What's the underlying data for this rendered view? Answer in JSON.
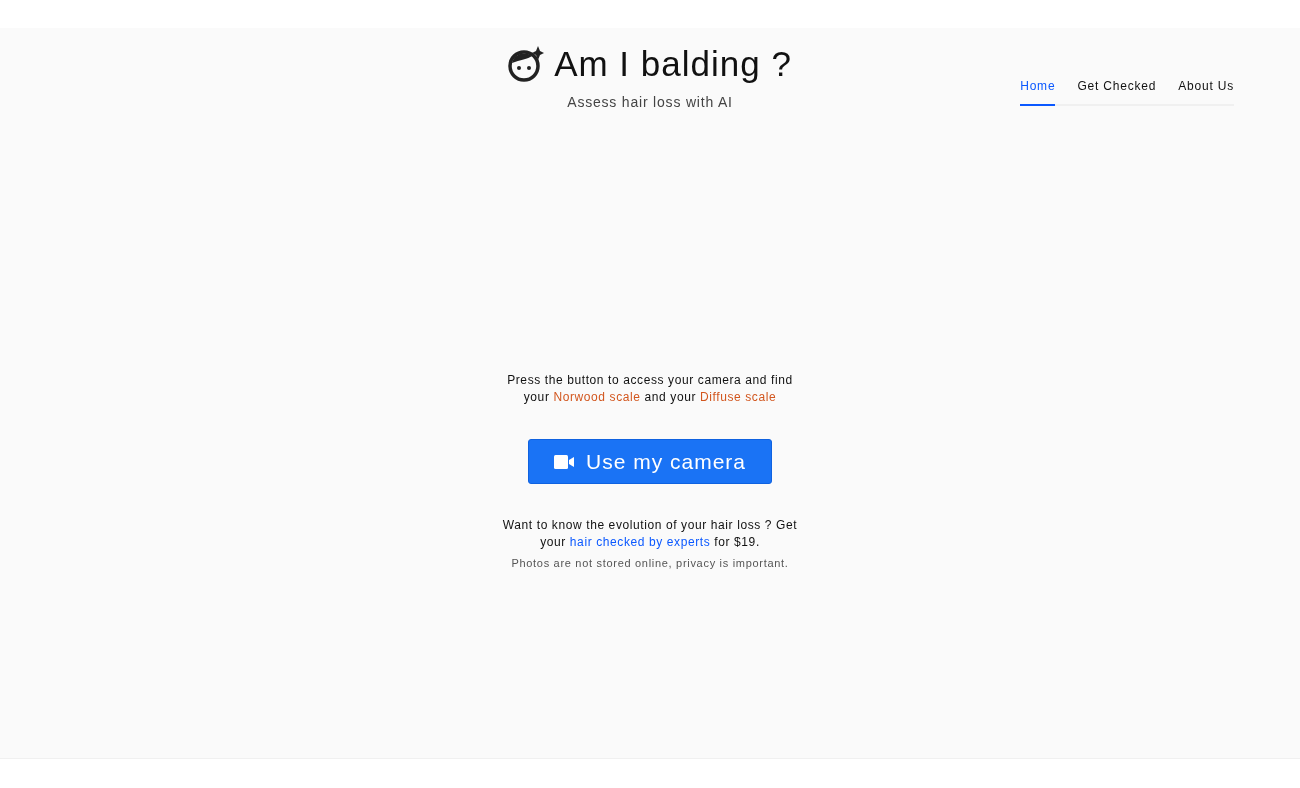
{
  "header": {
    "title": "Am I balding ?",
    "subtitle": "Assess hair loss with AI"
  },
  "nav": [
    {
      "label": "Home",
      "selected": true
    },
    {
      "label": "Get Checked",
      "selected": false
    },
    {
      "label": "About Us",
      "selected": false
    }
  ],
  "intro": [
    {
      "kind": "text",
      "text": "Press the button to access your camera and find your "
    },
    {
      "kind": "scale-link",
      "text": "Norwood scale"
    },
    {
      "kind": "text",
      "text": " and your "
    },
    {
      "kind": "scale-link",
      "text": "Diffuse scale"
    }
  ],
  "camera_button": {
    "label": "Use my camera"
  },
  "offer": [
    {
      "kind": "text",
      "text": "Want to know the evolution of your hair loss ? Get your "
    },
    {
      "kind": "offer-link",
      "text": "hair checked by experts"
    },
    {
      "kind": "text",
      "text": " for $19."
    }
  ],
  "privacy_note": "Photos are not stored online, privacy is important."
}
